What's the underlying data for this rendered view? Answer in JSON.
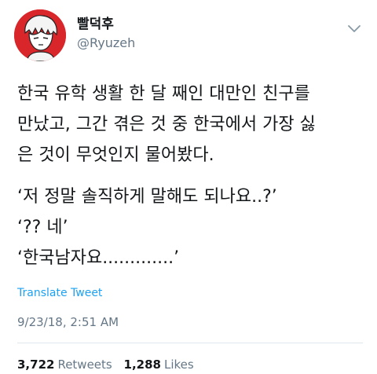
{
  "user": {
    "display_name": "빨덕후",
    "handle": "@Ryuzeh"
  },
  "tweet": {
    "line1": "한국 유학 생활 한 달 째인 대만인 친구를",
    "line2": "만났고, 그간 겪은 것 중 한국에서 가장 싫",
    "line3": "은 것이 무엇인지 물어봤다.",
    "quote1": "‘저 정말 솔직하게 말해도 되나요..?’",
    "quote2": "‘?? 네’",
    "quote3": "‘한국남자요.............’"
  },
  "translate_label": "Translate Tweet",
  "timestamp": "9/23/18, 2:51 AM",
  "stats": {
    "retweets_count": "3,722",
    "retweets_label": "Retweets",
    "likes_count": "1,288",
    "likes_label": "Likes"
  },
  "colors": {
    "link": "#1da1f2",
    "secondary_text": "#657786",
    "avatar_background": "#d9262b"
  },
  "icons": {
    "avatar": "cartoon-character-avatar",
    "menu": "chevron-down-icon"
  }
}
